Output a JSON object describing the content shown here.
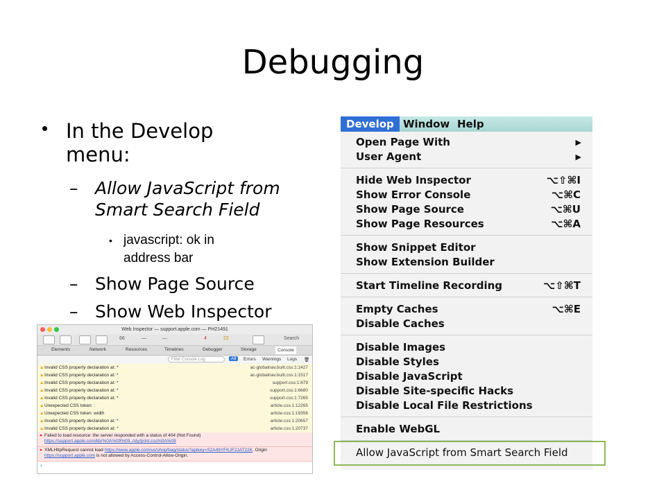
{
  "slide": {
    "title": "Debugging",
    "bullets": {
      "l1": "In the Develop",
      "l1b": "menu:",
      "s1": "Allow JavaScript from",
      "s1b": "Smart Search Field",
      "s1_sub": "javascript: ok in",
      "s1_subb": "address bar",
      "s2": "Show Page Source",
      "s3": "Show Web Inspector",
      "dash": "–",
      "dot": "•"
    }
  },
  "menu": {
    "bar": [
      "Develop",
      "Window",
      "Help"
    ],
    "items": [
      {
        "label": "Open Page With",
        "shortcut": "▶"
      },
      {
        "label": "User Agent",
        "shortcut": "▶"
      },
      {
        "label": "Hide Web Inspector",
        "shortcut": "⌥⇧⌘I"
      },
      {
        "label": "Show Error Console",
        "shortcut": "⌥⌘C"
      },
      {
        "label": "Show Page Source",
        "shortcut": "⌥⌘U"
      },
      {
        "label": "Show Page Resources",
        "shortcut": "⌥⌘A"
      },
      {
        "label": "Show Snippet Editor",
        "shortcut": ""
      },
      {
        "label": "Show Extension Builder",
        "shortcut": ""
      },
      {
        "label": "Start Timeline Recording",
        "shortcut": "⌥⇧⌘T"
      },
      {
        "label": "Empty Caches",
        "shortcut": "⌥⌘E"
      },
      {
        "label": "Disable Caches",
        "shortcut": ""
      },
      {
        "label": "Disable Images",
        "shortcut": ""
      },
      {
        "label": "Disable Styles",
        "shortcut": ""
      },
      {
        "label": "Disable JavaScript",
        "shortcut": ""
      },
      {
        "label": "Disable Site-specific Hacks",
        "shortcut": ""
      },
      {
        "label": "Disable Local File Restrictions",
        "shortcut": ""
      },
      {
        "label": "Enable WebGL",
        "shortcut": ""
      },
      {
        "label": "Allow JavaScript from Smart Search Field",
        "shortcut": ""
      }
    ]
  },
  "inspector": {
    "title": "Web Inspector — support.apple.com — PH21491",
    "toolbar": {
      "resources": "66",
      "dash1": "—",
      "dash2": "—",
      "errors": "4",
      "warnings": "22",
      "search": "Search"
    },
    "tabs": [
      "Elements",
      "Network",
      "Resources",
      "Timelines",
      "Debugger",
      "Storage",
      "Console"
    ],
    "filter": {
      "placeholder": "Filter Console Log",
      "all": "All",
      "errors": "Errors",
      "warnings": "Warnings",
      "logs": "Logs"
    },
    "logs": [
      {
        "msg": "Invalid CSS property declaration at: *",
        "src": "ac-globalnav.built.css:1:1427"
      },
      {
        "msg": "Invalid CSS property declaration at: *",
        "src": "ac-globalnav.built.css:1:1517"
      },
      {
        "msg": "Invalid CSS property declaration at: *",
        "src": "support.css:1:879"
      },
      {
        "msg": "Invalid CSS property declaration at: *",
        "src": "support.css:1:6680"
      },
      {
        "msg": "Invalid CSS property declaration at: *",
        "src": "support.css:1:7265"
      },
      {
        "msg": "Unexpected CSS token: :",
        "src": "article.css:1:12265"
      },
      {
        "msg": "Unexpected CSS token: width",
        "src": "article.css:1:19356"
      },
      {
        "msg": "Invalid CSS property declaration at: *",
        "src": "article.css:1:20657"
      },
      {
        "msg": "Invalid CSS property declaration at: *",
        "src": "article.css:1:20737"
      }
    ],
    "err1": {
      "msg": "Failed to load resource: the server responded with a status of 404 (Not Found)",
      "link": "https://support.apple.com/kb/%0A%09%09../sty/print.css%0A%09"
    },
    "err2": {
      "msg": "XMLHttpRequest cannot load",
      "link": "https://www.apple.com/us/shop/bag/status?apikey=S2A49YFKJF2JAT22K",
      "msg2": ". Origin",
      "link2": "https://support.apple.com",
      "msg3": " is not allowed by Access-Control-Allow-Origin."
    },
    "prompt": "›"
  },
  "colors": {
    "menu_highlight": "#2f6fd6",
    "highlight_box": "#8bb85a"
  }
}
